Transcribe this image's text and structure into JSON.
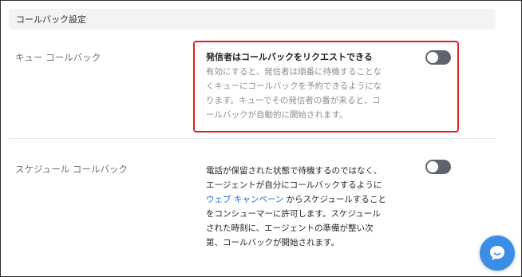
{
  "section": {
    "title": "コールバック設定"
  },
  "queue_callback": {
    "label": "キュー コールバック",
    "option_title": "発信者はコールバックをリクエストできる",
    "description": "有効にすると、発信者は順番に待機することな\nくキューにコールバックを予約できるようにな\nります。キューでその発信者の番が来ると、コ\nールバックが自動的に開始されます。",
    "enabled": false
  },
  "scheduled_callback": {
    "label": "スケジュール コールバック",
    "description_line1": "電話が保留された状態で待機するのではなく、",
    "description_line2": "エージェントが自分にコールバックするように",
    "link_text": "ウェブ キャンペーン",
    "description_line3_rest": " からスケジュールすること",
    "description_rest": "をコンシューマーに許可します。スケジュール\nされた時刻に、エージェントの準備が整い次\n第、コールバックが開始されます。",
    "enabled": false
  },
  "chat_button": {
    "icon": "chat-bubble-icon"
  },
  "colors": {
    "highlight_border": "#e02020",
    "toggle_off": "#5f6370",
    "link": "#1a6fd9",
    "fab": "#3a8ee6"
  }
}
